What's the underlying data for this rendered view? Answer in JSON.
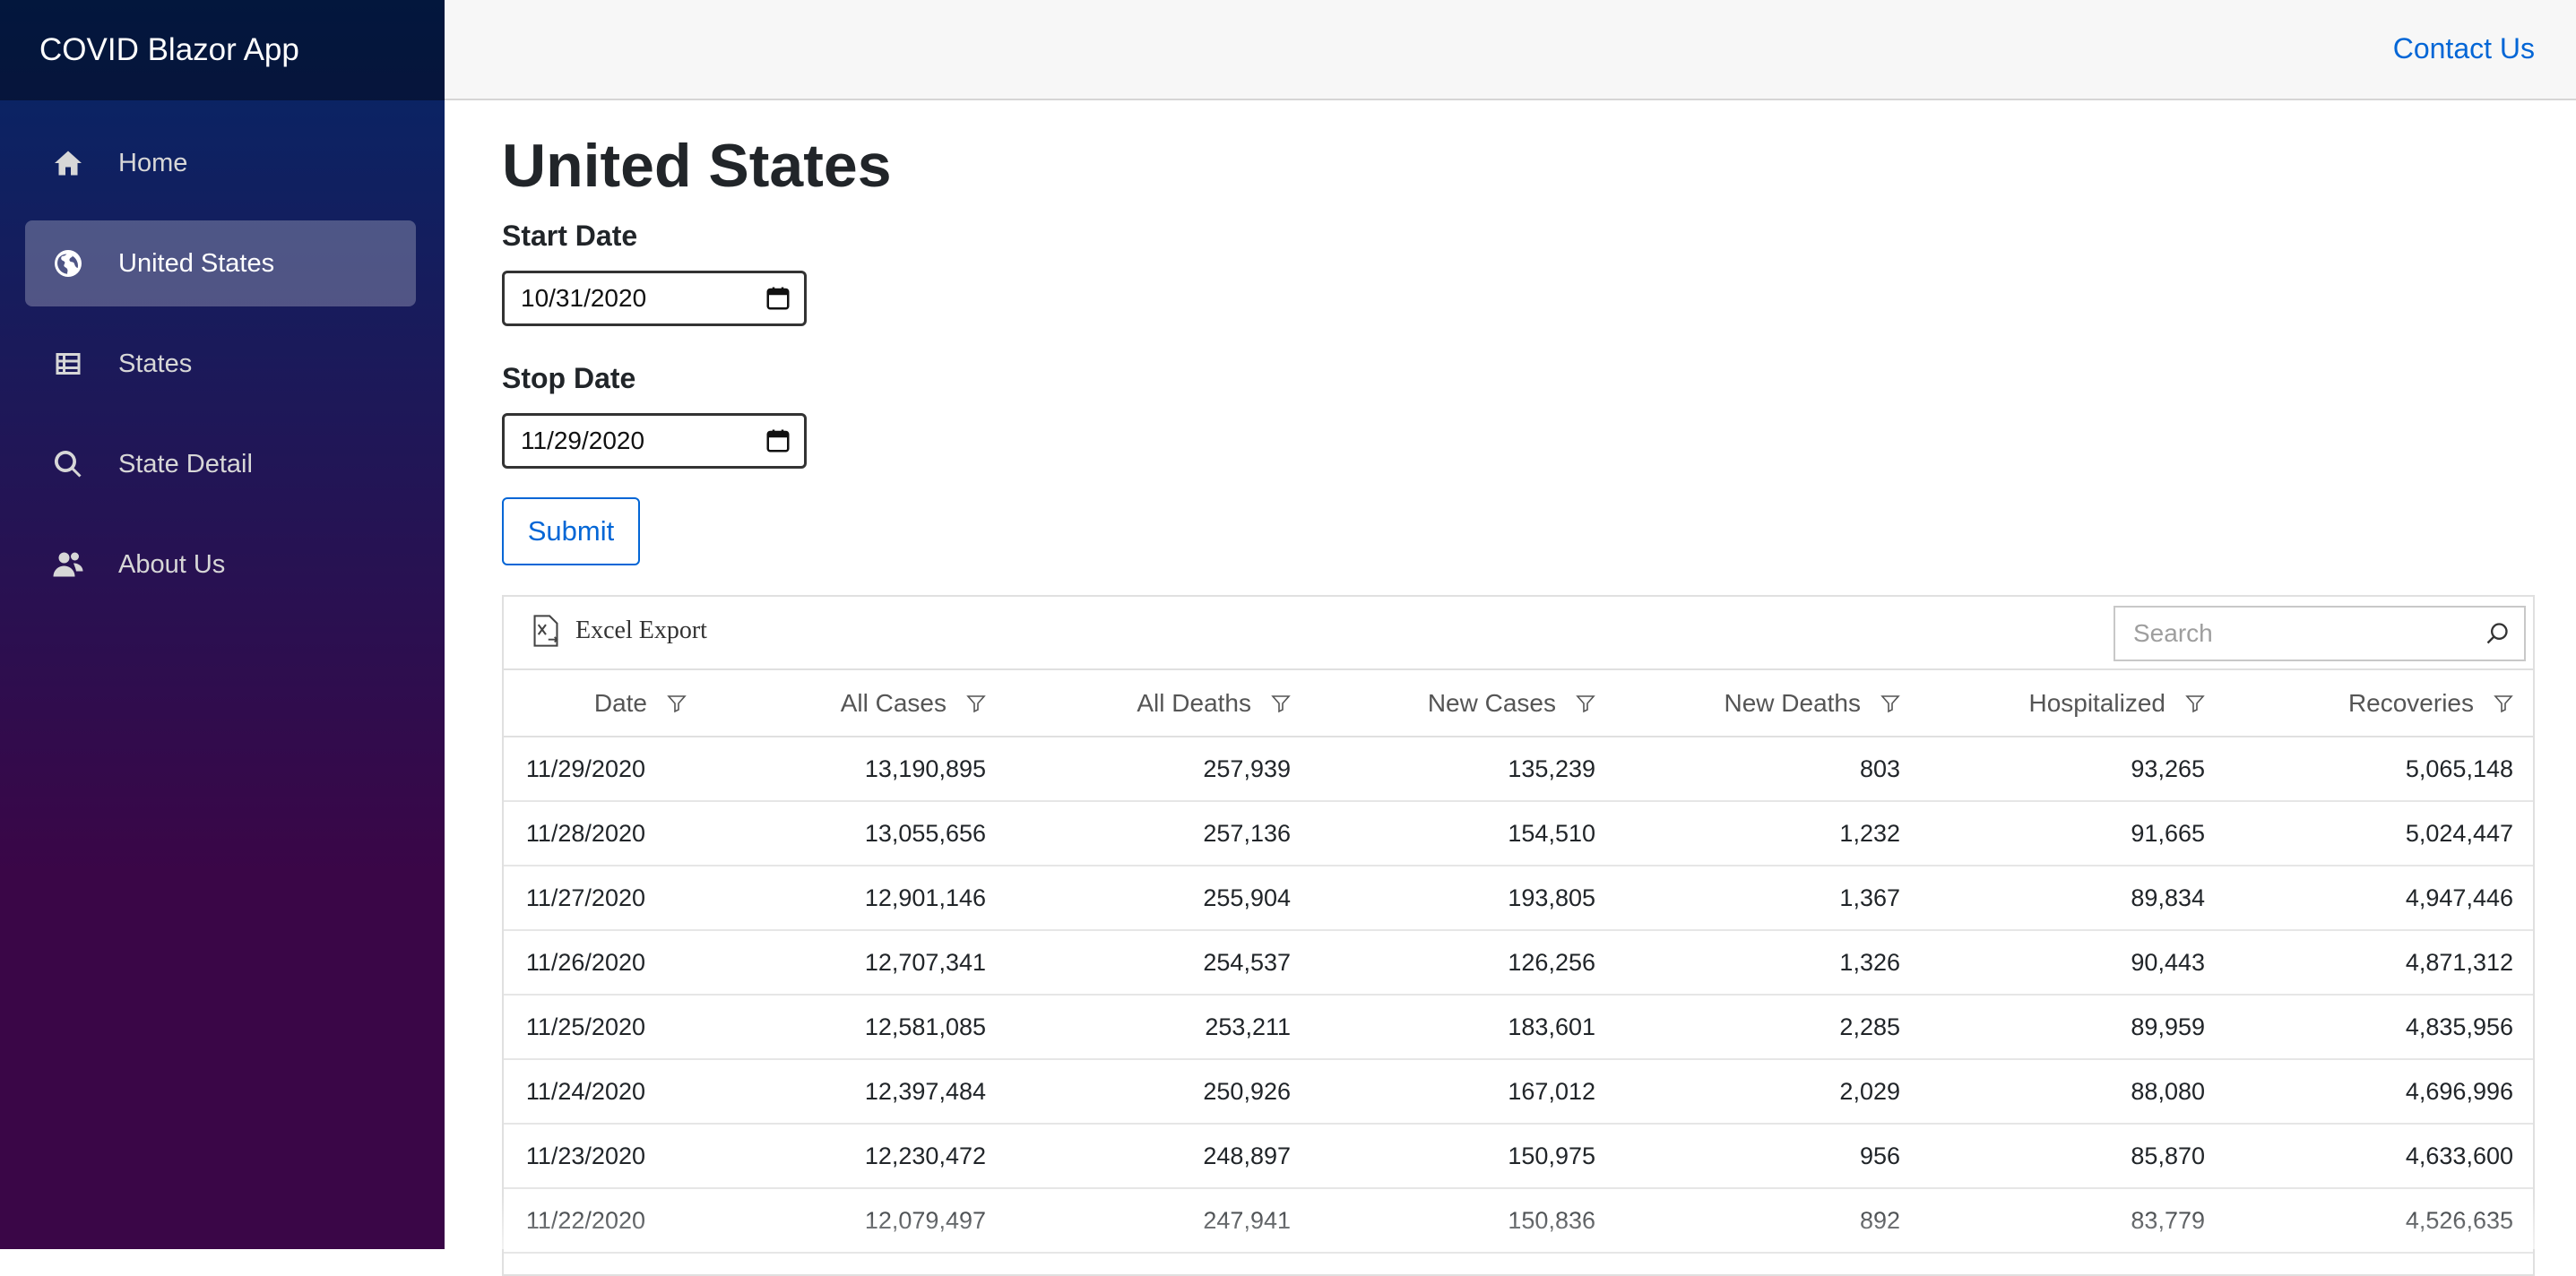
{
  "app": {
    "title": "COVID Blazor App"
  },
  "topbar": {
    "contact_label": "Contact Us"
  },
  "sidebar": {
    "items": [
      {
        "label": "Home",
        "icon": "home-icon",
        "active": false
      },
      {
        "label": "United States",
        "icon": "globe-icon",
        "active": true
      },
      {
        "label": "States",
        "icon": "list-icon",
        "active": false
      },
      {
        "label": "State Detail",
        "icon": "search-icon",
        "active": false
      },
      {
        "label": "About Us",
        "icon": "people-icon",
        "active": false
      }
    ]
  },
  "main": {
    "title": "United States",
    "start_label": "Start Date",
    "start_value": "10/31/2020",
    "stop_label": "Stop Date",
    "stop_value": "11/29/2020",
    "submit_label": "Submit"
  },
  "grid": {
    "excel_label": "Excel Export",
    "search_placeholder": "Search",
    "columns": [
      "Date",
      "All Cases",
      "All Deaths",
      "New Cases",
      "New Deaths",
      "Hospitalized",
      "Recoveries"
    ],
    "rows": [
      [
        "11/29/2020",
        "13,190,895",
        "257,939",
        "135,239",
        "803",
        "93,265",
        "5,065,148"
      ],
      [
        "11/28/2020",
        "13,055,656",
        "257,136",
        "154,510",
        "1,232",
        "91,665",
        "5,024,447"
      ],
      [
        "11/27/2020",
        "12,901,146",
        "255,904",
        "193,805",
        "1,367",
        "89,834",
        "4,947,446"
      ],
      [
        "11/26/2020",
        "12,707,341",
        "254,537",
        "126,256",
        "1,326",
        "90,443",
        "4,871,312"
      ],
      [
        "11/25/2020",
        "12,581,085",
        "253,211",
        "183,601",
        "2,285",
        "89,959",
        "4,835,956"
      ],
      [
        "11/24/2020",
        "12,397,484",
        "250,926",
        "167,012",
        "2,029",
        "88,080",
        "4,696,996"
      ],
      [
        "11/23/2020",
        "12,230,472",
        "248,897",
        "150,975",
        "956",
        "85,870",
        "4,633,600"
      ],
      [
        "11/22/2020",
        "12,079,497",
        "247,941",
        "150,836",
        "892",
        "83,779",
        "4,526,635"
      ]
    ]
  }
}
